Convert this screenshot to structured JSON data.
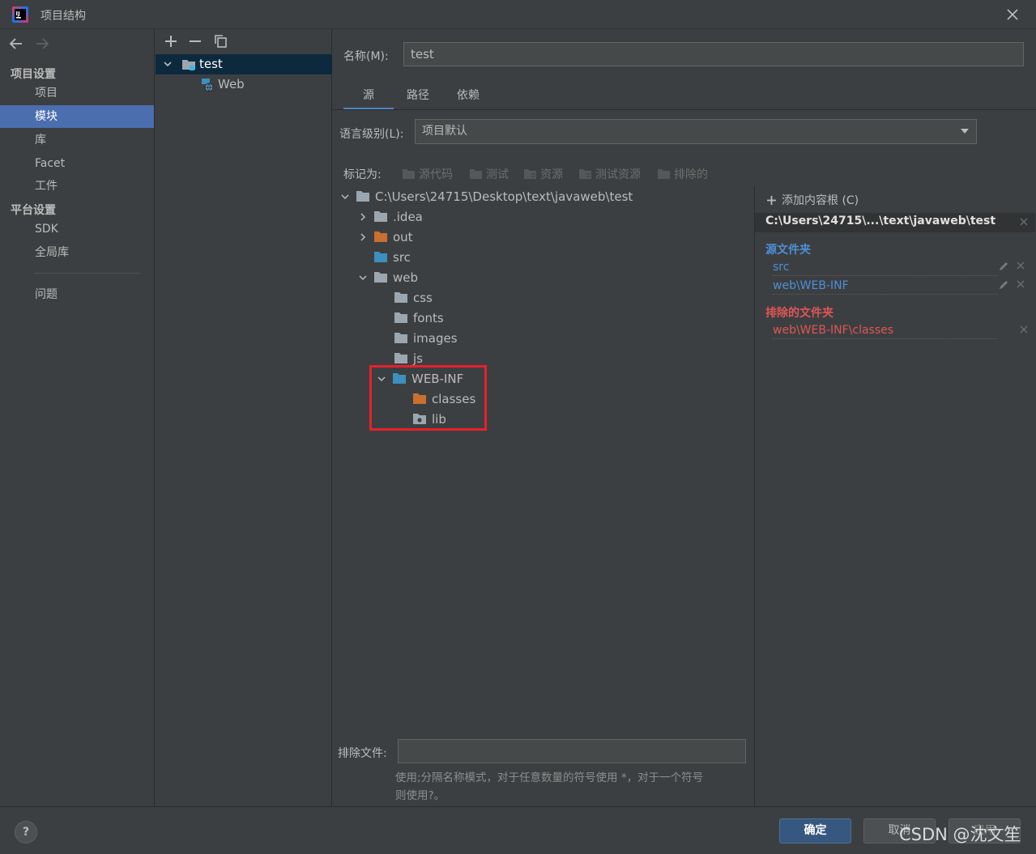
{
  "window": {
    "title": "项目结构"
  },
  "nav": {
    "sections": [
      {
        "title": "项目设置",
        "items": [
          "项目",
          "模块",
          "库",
          "Facet",
          "工件"
        ]
      },
      {
        "title": "平台设置",
        "items": [
          "SDK",
          "全局库"
        ]
      }
    ],
    "problems": "问题",
    "selected": "模块"
  },
  "modules": {
    "root": "test",
    "child": "Web"
  },
  "form": {
    "name_label": "名称(M):",
    "name_value": "test",
    "tabs": [
      "源",
      "路径",
      "依赖"
    ],
    "active_tab": "源",
    "lang_label": "语言级别(L):",
    "lang_value": "项目默认",
    "mark_as_label": "标记为:",
    "mark_buttons": [
      "源代码",
      "测试",
      "资源",
      "测试资源",
      "排除的"
    ],
    "exclude_label": "排除文件:",
    "exclude_value": "",
    "hint_line1": "使用;分隔名称模式，对于任意数量的符号使用 *，对于一个符号",
    "hint_line2": "则使用?。"
  },
  "tree": {
    "root": "C:\\Users\\24715\\Desktop\\text\\javaweb\\test",
    "idea": ".idea",
    "out": "out",
    "src": "src",
    "web": "web",
    "css": "css",
    "fonts": "fonts",
    "images": "images",
    "js": "js",
    "webinf": "WEB-INF",
    "classes": "classes",
    "lib": "lib"
  },
  "content_root": {
    "add_label": "添加内容根 (C)",
    "path": "C:\\Users\\24715\\...\\text\\javaweb\\test",
    "source_title": "源文件夹",
    "sources": [
      "src",
      "web\\WEB-INF"
    ],
    "excluded_title": "排除的文件夹",
    "excluded": [
      "web\\WEB-INF\\classes"
    ]
  },
  "footer": {
    "help": "?",
    "ok": "确定",
    "cancel": "取消",
    "apply": "应用",
    "watermark": "CSDN @沈文笙"
  },
  "colors": {
    "accent": "#4b6eaf",
    "source_blue": "#4d8fd8",
    "excluded_red": "#e05555",
    "excluded_folder": "#c7702f",
    "source_folder": "#3d8fbd",
    "highlight": "#e8202a"
  }
}
